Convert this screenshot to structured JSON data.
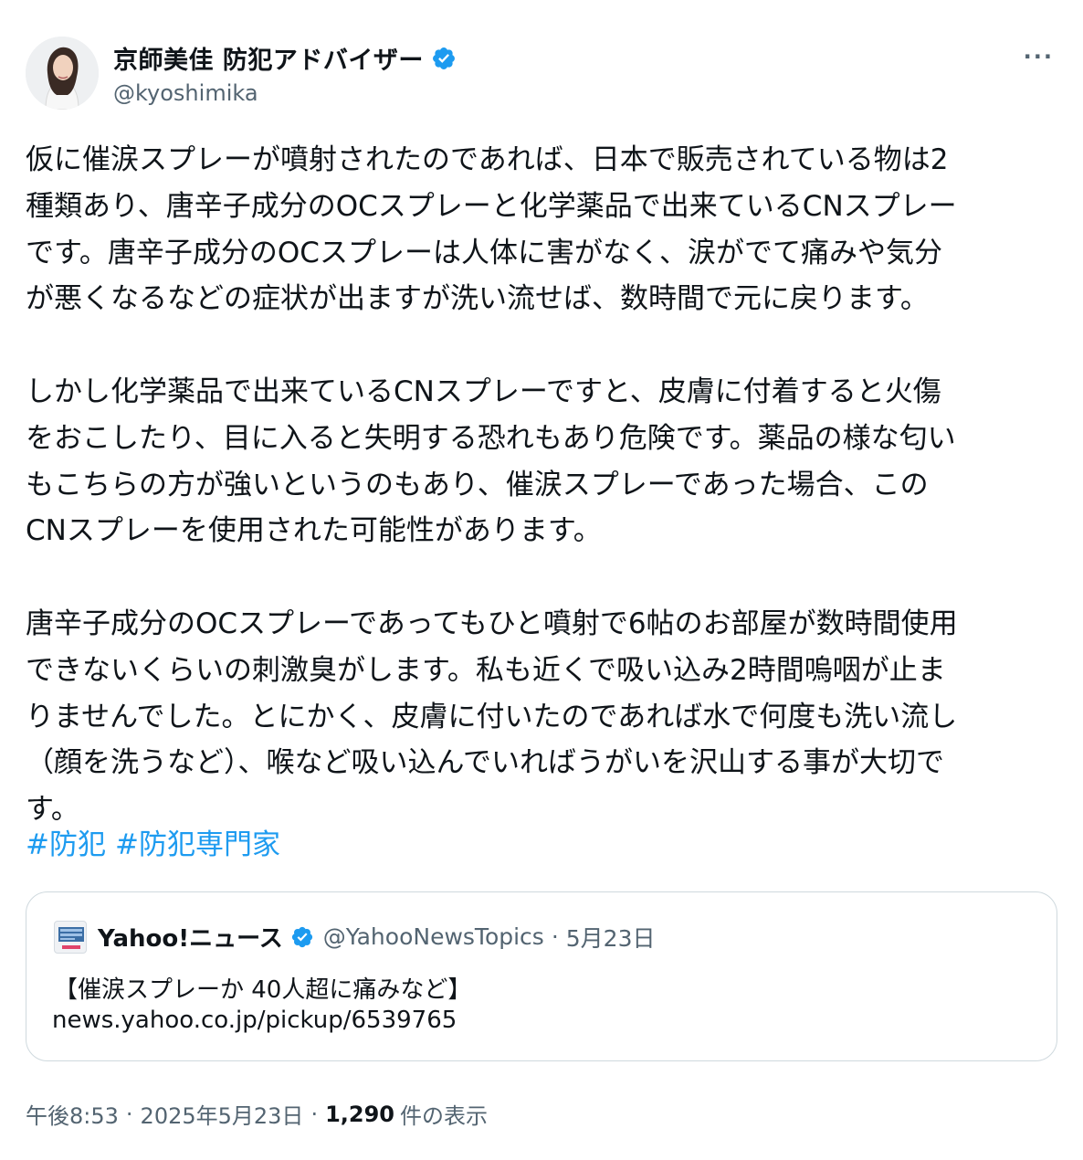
{
  "author": {
    "display_name": "京師美佳 防犯アドバイザー",
    "handle": "@kyoshimika",
    "verified": true
  },
  "more_icon": "more-options-icon",
  "body": {
    "paragraphs": [
      "仮に催涙スプレーが噴射されたのであれば、日本で販売されている物は2\n種類あり、唐辛子成分のOCスプレーと化学薬品で出来ているCNスプレー\nです。唐辛子成分のOCスプレーは人体に害がなく、涙がでて痛みや気分\nが悪くなるなどの症状が出ますが洗い流せば、数時間で元に戻ります。",
      "しかし化学薬品で出来ているCNスプレーですと、皮膚に付着すると火傷\nをおこしたり、目に入ると失明する恐れもあり危険です。薬品の様な匂い\nもこちらの方が強いというのもあり、催涙スプレーであった場合、この\nCNスプレーを使用された可能性があります。",
      "唐辛子成分のOCスプレーであってもひと噴射で6帖のお部屋が数時間使用\nできないくらいの刺激臭がします。私も近くで吸い込み2時間嗚咽が止ま\nりませんでした。とにかく、皮膚に付いたのであれば水で何度も洗い流し\n（顔を洗うなど）、喉など吸い込んでいればうがいを沢山する事が大切で\nす。"
    ],
    "hashtags": [
      "#防犯",
      "#防犯専門家"
    ]
  },
  "quote": {
    "name": "Yahoo!ニュース",
    "handle": "@YahooNewsTopics",
    "dot": "·",
    "date": "5月23日",
    "title": "【催涙スプレーか 40人超に痛みなど】",
    "link": "news.yahoo.co.jp/pickup/6539765"
  },
  "footer": {
    "time": "午後8:53",
    "date": "2025年5月23日",
    "views_count": "1,290",
    "views_label": "件の表示",
    "sep": "·"
  },
  "colors": {
    "text": "#0f1419",
    "secondary": "#536471",
    "link": "#1d9bf0",
    "border": "#cfd9de"
  }
}
